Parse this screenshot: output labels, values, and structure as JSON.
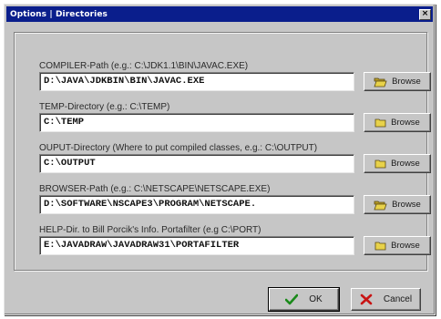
{
  "window": {
    "title": "Options | Directories",
    "close_glyph": "×"
  },
  "rows": [
    {
      "label": "COMPILER-Path (e.g.: C:\\JDK1.1\\BIN\\JAVAC.EXE)",
      "value": "D:\\JAVA\\JDKBIN\\BIN\\JAVAC.EXE",
      "button": "Browse",
      "icon": "open-folder-icon"
    },
    {
      "label": "TEMP-Directory (e.g.: C:\\TEMP)",
      "value": "C:\\TEMP",
      "button": "Browse",
      "icon": "folder-icon"
    },
    {
      "label": "OUPUT-Directory (Where to put compiled classes, e.g.: C:\\OUTPUT)",
      "value": "C:\\OUTPUT",
      "button": "Browse",
      "icon": "folder-icon"
    },
    {
      "label": "BROWSER-Path (e.g.: C:\\NETSCAPE\\NETSCAPE.EXE)",
      "value": "D:\\SOFTWARE\\NSCAPE3\\PROGRAM\\NETSCAPE.",
      "button": "Browse",
      "icon": "open-folder-icon"
    },
    {
      "label": "HELP-Dir. to Bill Porcik's Info. Portafilter (e.g C:\\PORT)",
      "value": "E:\\JAVADRAW\\JAVADRAW31\\PORTAFILTER",
      "button": "Browse",
      "icon": "folder-icon"
    }
  ],
  "buttons": {
    "ok_label": "OK",
    "cancel_label": "Cancel"
  },
  "colors": {
    "titlebar": "#0a1e8c",
    "face": "#c6c6c6",
    "ok_check": "#1a8a1a",
    "cancel_x": "#c81414",
    "folder": "#e8d24a"
  }
}
